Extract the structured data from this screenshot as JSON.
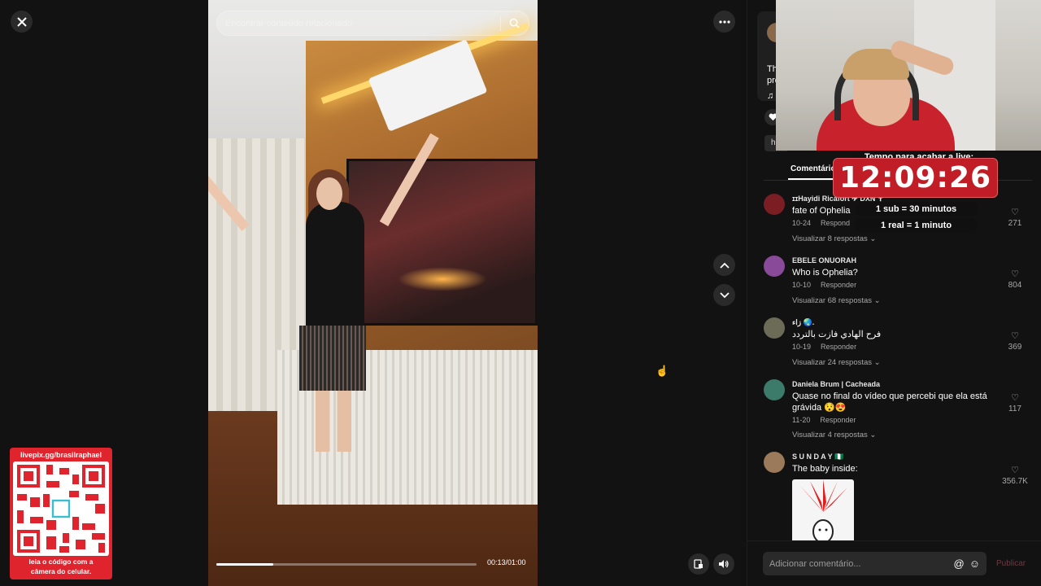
{
  "search": {
    "placeholder": "Encontrar conteúdo relacionado"
  },
  "player": {
    "time": "00:13/01:00",
    "progress": 0.22
  },
  "qr": {
    "url": "livepix.gg/brasilraphael",
    "note_line1": "leia o código com a",
    "note_line2": "câmera do celular."
  },
  "caption": {
    "text": "Th pro",
    "music_icon": "♫"
  },
  "tabs": {
    "comments": "Comentário"
  },
  "timer": {
    "label": "Tempo para acabar a live:",
    "value": "12:09:26",
    "rule1": "1 sub = 30 minutos",
    "rule2": "1 real = 1 minuto"
  },
  "comments": [
    {
      "user": "ɪɪHayidi Ricafort ✈ DXN ✝",
      "text": "fate of Ophelia",
      "date": "10-24",
      "reply": "Respond",
      "replies": "Visualizar 8 respostas",
      "likes": "271",
      "avatar": "#7a1e24"
    },
    {
      "user": "EBELE ONUORAH",
      "text": "Who is Ophelia?",
      "date": "10-10",
      "reply": "Responder",
      "replies": "Visualizar 68 respostas",
      "likes": "804",
      "avatar": "#8a4a9a"
    },
    {
      "user": "زاء 🌏.",
      "text": "فرح الهادي فازت بالتردد",
      "date": "10-19",
      "reply": "Responder",
      "replies": "Visualizar 24 respostas",
      "likes": "369",
      "avatar": "#6b6b58"
    },
    {
      "user": "Daniela Brum | Cacheada",
      "text": "Quase no final do vídeo que percebi que ela está grávida 😯😍",
      "date": "11-20",
      "reply": "Responder",
      "replies": "Visualizar 4 respostas",
      "likes": "117",
      "avatar": "#3c7a6a"
    },
    {
      "user": "S U N D A Y 🇳🇬",
      "text": "The baby inside:",
      "likes": "356.7K",
      "avatar": "#9a7a5a"
    }
  ],
  "footer": {
    "placeholder": "Adicionar comentário...",
    "publish": "Publicar",
    "mention_icon": "@",
    "emoji_icon": "☺"
  },
  "icons": {
    "close": "close-icon",
    "more": "more-icon",
    "up": "chevron-up-icon",
    "down": "chevron-down-icon",
    "search": "search-icon",
    "volume": "volume-icon",
    "mini": "miniplayer-icon",
    "heart": "heart-icon"
  }
}
